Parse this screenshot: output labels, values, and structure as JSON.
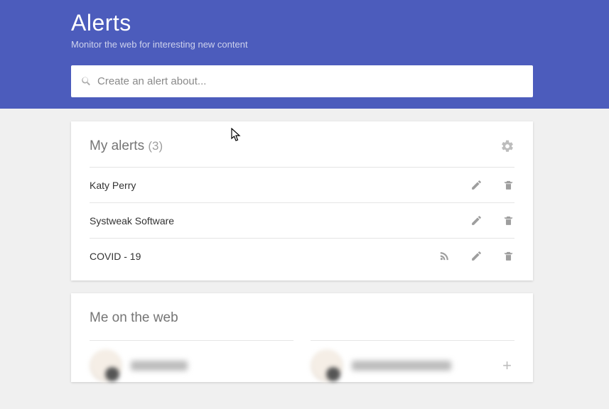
{
  "header": {
    "title": "Alerts",
    "subtitle": "Monitor the web for interesting new content"
  },
  "search": {
    "placeholder": "Create an alert about..."
  },
  "my_alerts": {
    "title": "My alerts",
    "count": "(3)",
    "items": [
      {
        "name": "Katy Perry",
        "has_rss": false
      },
      {
        "name": "Systweak Software",
        "has_rss": false
      },
      {
        "name": "COVID - 19",
        "has_rss": true
      }
    ]
  },
  "web": {
    "title": "Me on the web"
  }
}
